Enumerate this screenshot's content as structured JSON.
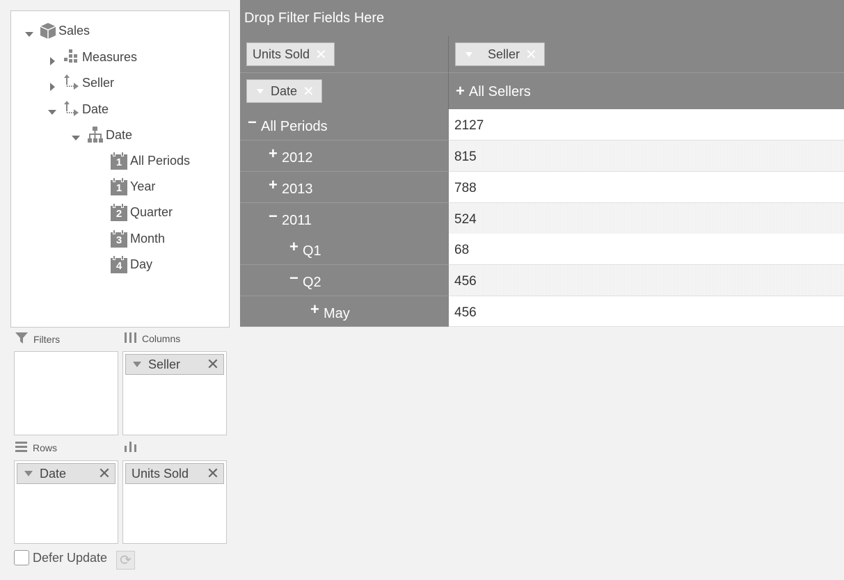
{
  "tree": {
    "cube": "Sales",
    "items": [
      {
        "label": "Measures"
      },
      {
        "label": "Seller"
      },
      {
        "label": "Date"
      },
      {
        "label": "Date"
      },
      {
        "label": "All Periods",
        "level": "1"
      },
      {
        "label": "Year",
        "level": "1"
      },
      {
        "label": "Quarter",
        "level": "2"
      },
      {
        "label": "Month",
        "level": "3"
      },
      {
        "label": "Day",
        "level": "4"
      }
    ]
  },
  "areas": {
    "filters": {
      "title": "Filters"
    },
    "columns": {
      "title": "Columns",
      "field": "Seller"
    },
    "rows": {
      "title": "Rows",
      "field": "Date"
    },
    "values": {
      "field": "Units Sold"
    }
  },
  "defer": {
    "label": "Defer Update"
  },
  "pivot": {
    "filter_zone": "Drop Filter Fields Here",
    "measure_chip": "Units Sold",
    "column_chip": "Seller",
    "row_chip": "Date",
    "column_header": {
      "sign": "+",
      "label": "All Sellers"
    },
    "rows": [
      {
        "sign": "−",
        "label": "All Periods",
        "value": "2127"
      },
      {
        "sign": "+",
        "label": "2012",
        "value": "815"
      },
      {
        "sign": "+",
        "label": "2013",
        "value": "788"
      },
      {
        "sign": "−",
        "label": "2011",
        "value": "524"
      },
      {
        "sign": "+",
        "label": "Q1",
        "value": "68"
      },
      {
        "sign": "−",
        "label": "Q2",
        "value": "456"
      },
      {
        "sign": "+",
        "label": "May",
        "value": "456"
      }
    ]
  },
  "icons": {
    "cube": "cube-icon",
    "measures": "measures-icon",
    "dimension": "dimension-icon",
    "hierarchy": "hierarchy-icon",
    "level": "calendar-level-icon",
    "filter": "filter-icon",
    "columns": "columns-icon",
    "rows": "rows-icon",
    "values": "values-icon",
    "refresh": "refresh-icon"
  },
  "colors": {
    "header_bg": "#878787",
    "panel_bg": "#f2f2f2",
    "cell_white": "#ffffff"
  }
}
